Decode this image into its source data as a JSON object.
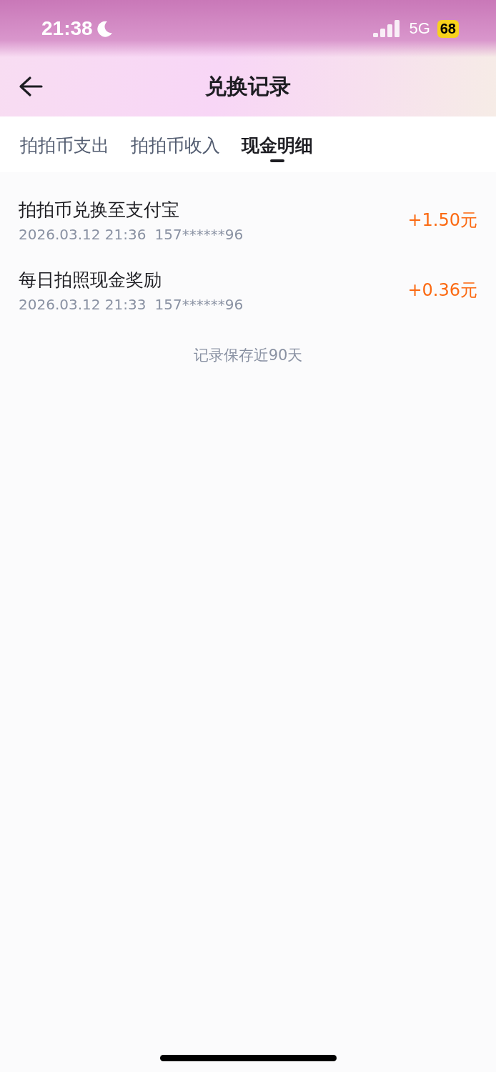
{
  "status_bar": {
    "time": "21:38",
    "network": "5G",
    "battery": "68"
  },
  "header": {
    "title": "兑换记录"
  },
  "tabs": [
    {
      "label": "拍拍币支出",
      "selected": false
    },
    {
      "label": "拍拍币收入",
      "selected": false
    },
    {
      "label": "现金明细",
      "selected": true
    }
  ],
  "records": [
    {
      "title": "拍拍币兑换至支付宝",
      "date": "2026.03.12 21:36",
      "account": "157******96",
      "amount": "+1.50元"
    },
    {
      "title": "每日拍照现金奖励",
      "date": "2026.03.12 21:33",
      "account": "157******96",
      "amount": "+0.36元"
    }
  ],
  "footer_note": "记录保存近90天"
}
